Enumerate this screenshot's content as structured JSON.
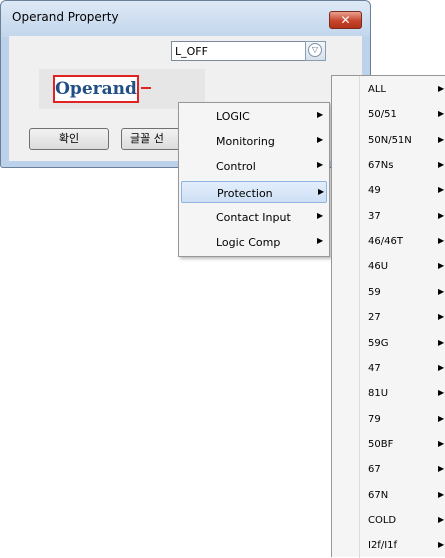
{
  "dialog": {
    "title": "Operand Property",
    "close_label": "✕",
    "preview_text": "Operand",
    "combo_value": "L_OFF",
    "ok_label": "확인",
    "font_label": "글꼴 선"
  },
  "submenu": {
    "items": [
      {
        "label": "LOGIC"
      },
      {
        "label": "Monitoring"
      },
      {
        "label": "Control"
      },
      {
        "label": "Protection",
        "highlighted": true
      },
      {
        "label": "Contact Input"
      },
      {
        "label": "Logic Comp"
      }
    ]
  },
  "protection_menu": {
    "items": [
      "ALL",
      "50/51",
      "50N/51N",
      "67Ns",
      "49",
      "37",
      "46/46T",
      "46U",
      "59",
      "27",
      "59G",
      "47",
      "81U",
      "79",
      "50BF",
      "67",
      "67N",
      "COLD",
      "I2f/I1f"
    ]
  },
  "icons": {
    "combo_dropdown": "chevron-down-circle-icon",
    "submenu_arrow": "arrow-right-icon"
  },
  "colors": {
    "highlight": "#cfe0f5",
    "preview_border": "#e02424",
    "preview_text": "#1f4f86",
    "close_button": "#c7452d"
  }
}
